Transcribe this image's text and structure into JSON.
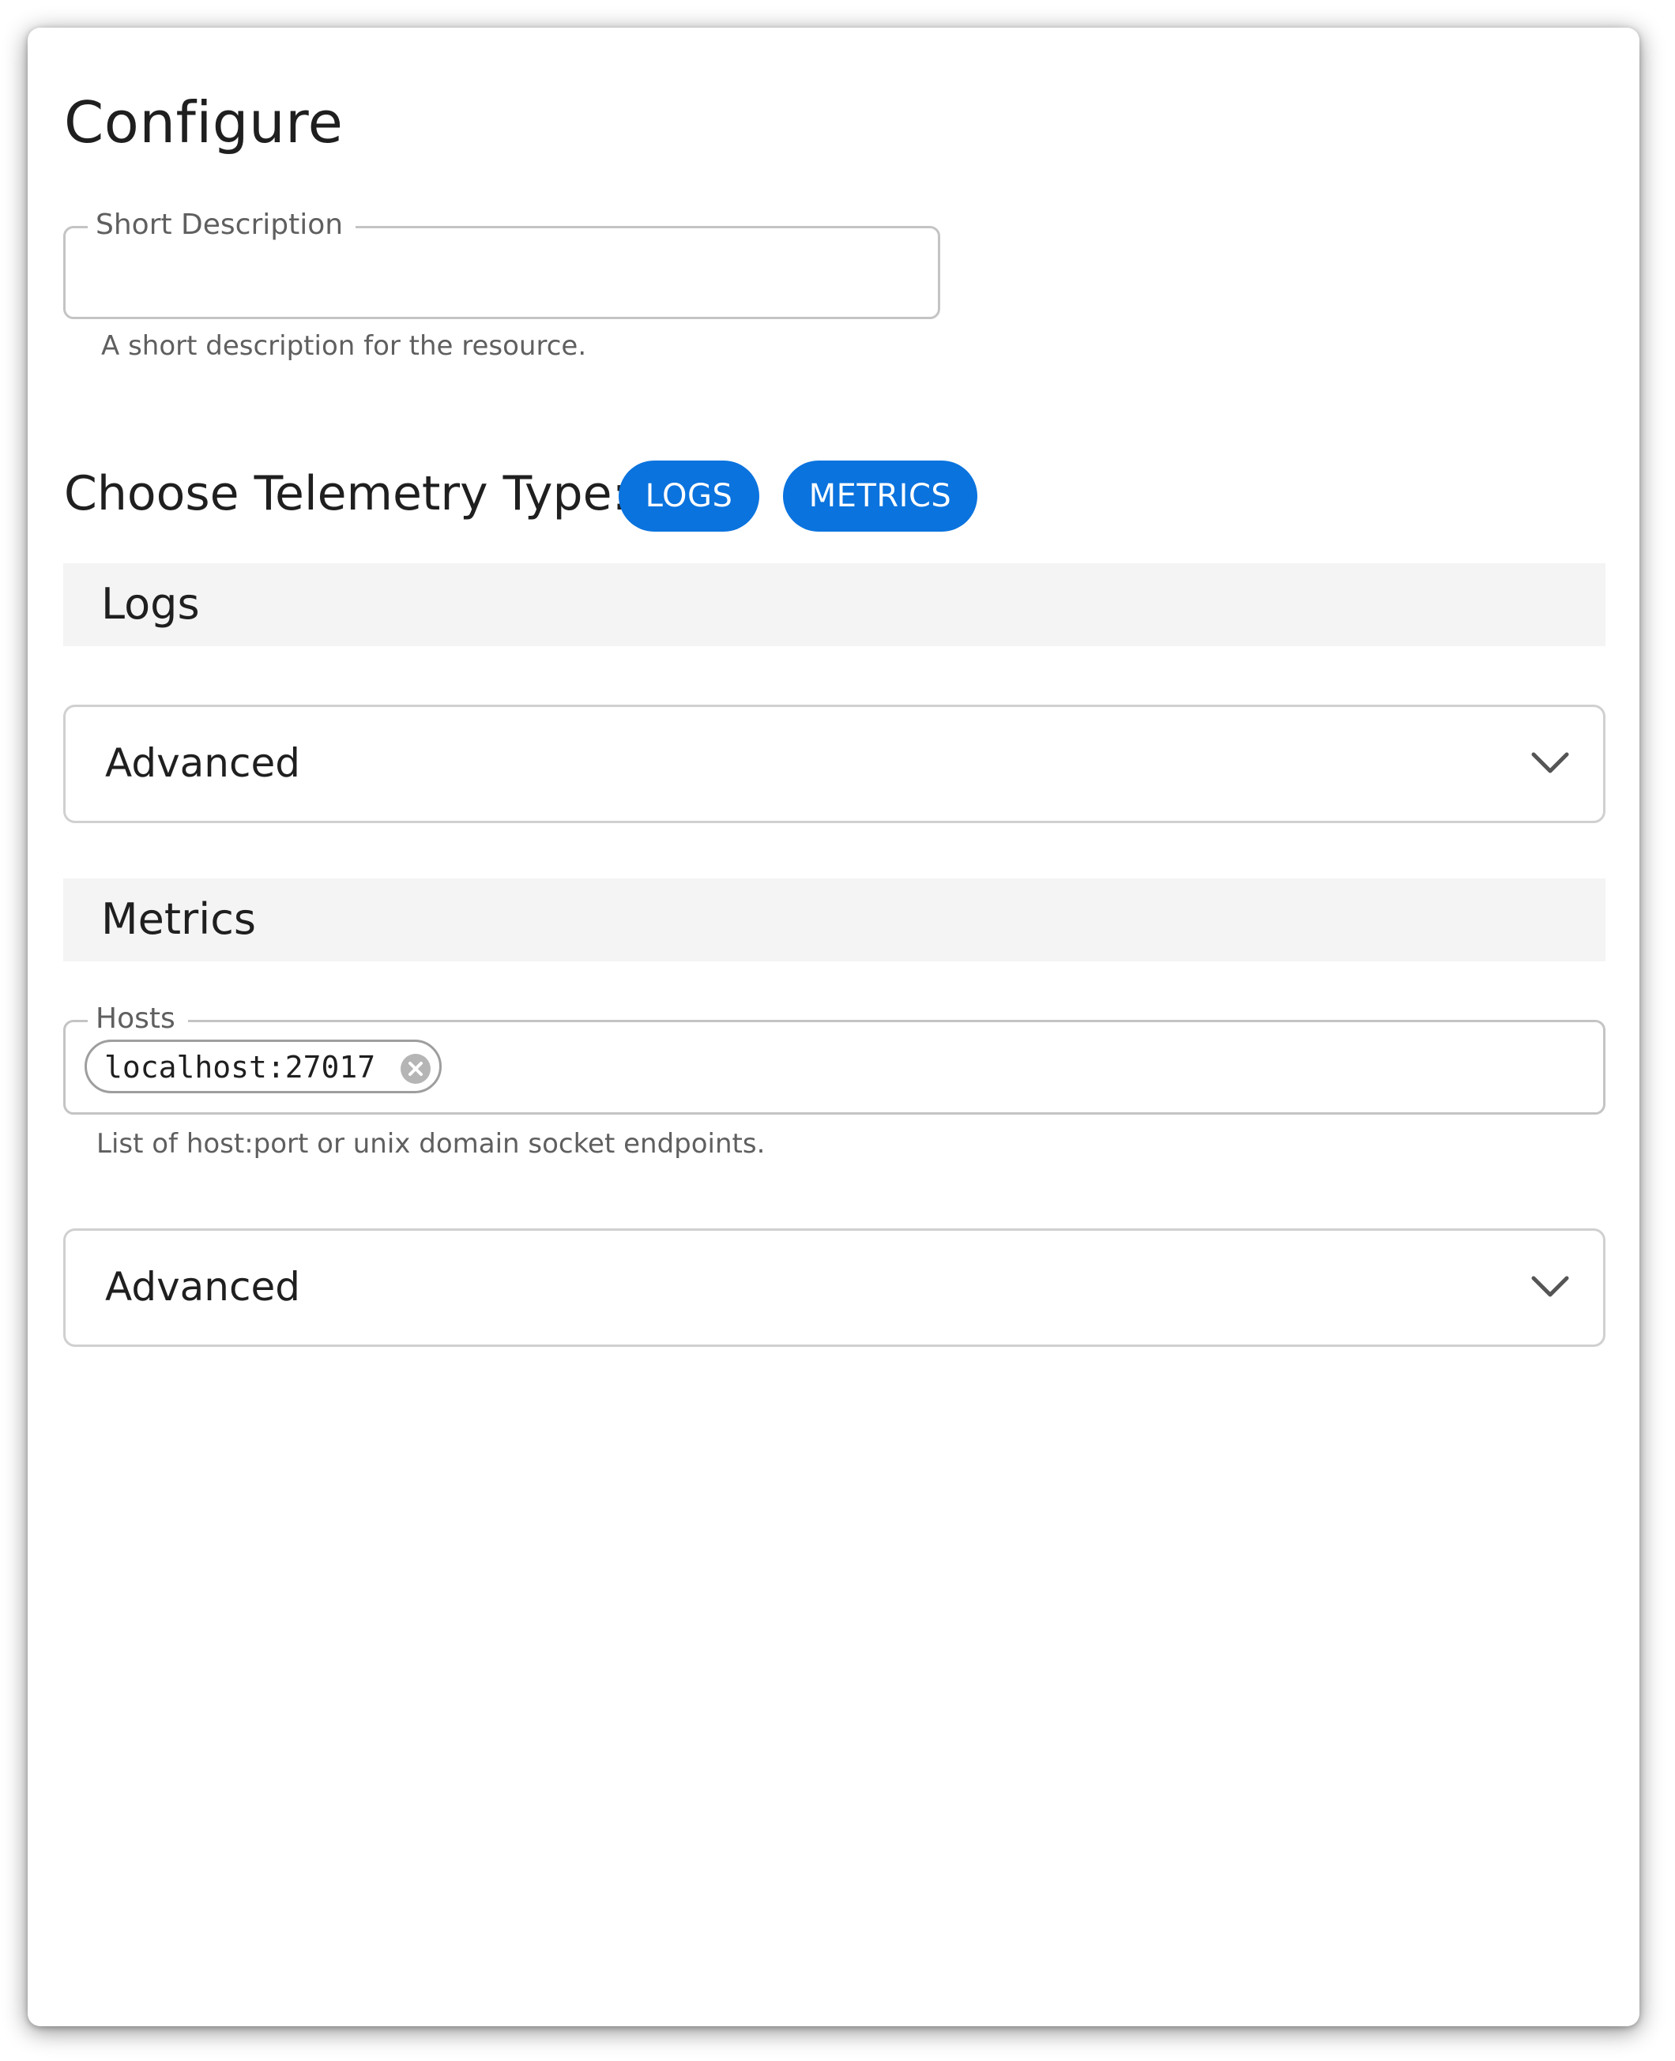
{
  "title": "Configure",
  "short_description": {
    "label": "Short Description",
    "value": "",
    "helper": "A short description for the resource."
  },
  "telemetry": {
    "label": "Choose Telemetry Type:",
    "options": [
      "LOGS",
      "METRICS"
    ]
  },
  "logs": {
    "header": "Logs",
    "advanced_label": "Advanced"
  },
  "metrics": {
    "header": "Metrics",
    "hosts": {
      "label": "Hosts",
      "chips": [
        "localhost:27017"
      ],
      "helper": "List of host:port or unix domain socket endpoints."
    },
    "advanced_label": "Advanced"
  },
  "colors": {
    "accent": "#0a73de",
    "section_bg": "#f4f4f4",
    "border": "#c4c4c4"
  },
  "icons": {
    "accordion": "chevron-down-icon",
    "chip_remove": "close-circle-icon"
  }
}
